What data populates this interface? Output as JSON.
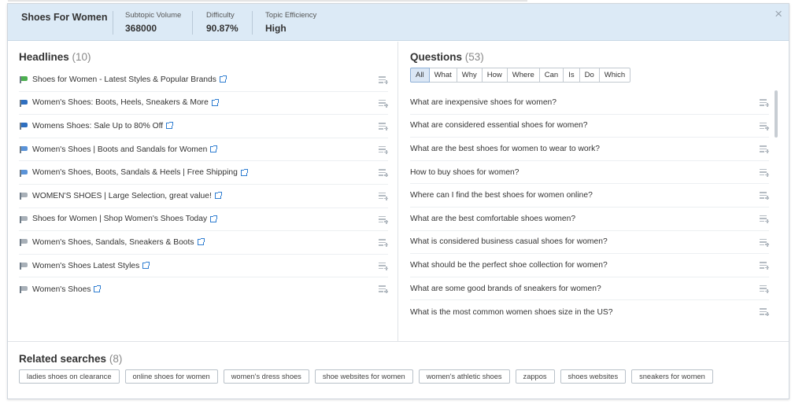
{
  "header": {
    "title": "Shoes For Women",
    "metrics": [
      {
        "label": "Subtopic Volume",
        "value": "368000"
      },
      {
        "label": "Difficulty",
        "value": "90.87%"
      },
      {
        "label": "Topic Efficiency",
        "value": "High"
      }
    ],
    "close_glyph": "×"
  },
  "headlines": {
    "title": "Headlines",
    "count": "(10)",
    "items": [
      {
        "text": "Shoes for Women - Latest Styles & Popular Brands",
        "flag": "green"
      },
      {
        "text": "Women's Shoes: Boots, Heels, Sneakers & More",
        "flag": "blue"
      },
      {
        "text": "Womens Shoes: Sale Up to 80% Off",
        "flag": "blue"
      },
      {
        "text": "Women's Shoes | Boots and Sandals for Women",
        "flag": "lightblue"
      },
      {
        "text": "Women's Shoes, Boots, Sandals & Heels | Free Shipping",
        "flag": "lightblue"
      },
      {
        "text": "WOMEN'S SHOES | Large Selection, great value!",
        "flag": "gray"
      },
      {
        "text": "Shoes for Women | Shop Women's Shoes Today",
        "flag": "gray"
      },
      {
        "text": "Women's Shoes, Sandals, Sneakers & Boots",
        "flag": "gray"
      },
      {
        "text": "Women's Shoes Latest Styles",
        "flag": "gray"
      },
      {
        "text": "Women's Shoes",
        "flag": "gray"
      }
    ]
  },
  "questions": {
    "title": "Questions",
    "count": "(53)",
    "filters": [
      "All",
      "What",
      "Why",
      "How",
      "Where",
      "Can",
      "Is",
      "Do",
      "Which"
    ],
    "active_filter": "All",
    "items": [
      "What are inexpensive shoes for women?",
      "What are considered essential shoes for women?",
      "What are the best shoes for women to wear to work?",
      "How to buy shoes for women?",
      "Where can I find the best shoes for women online?",
      "What are the best comfortable shoes women?",
      "What is considered business casual shoes for women?",
      "What should be the perfect shoe collection for women?",
      "What are some good brands of sneakers for women?",
      "What is the most common women shoes size in the US?"
    ]
  },
  "related": {
    "title": "Related searches",
    "count": "(8)",
    "items": [
      "ladies shoes on clearance",
      "online shoes for women",
      "women's dress shoes",
      "shoe websites for women",
      "women's athletic shoes",
      "zappos",
      "shoes websites",
      "sneakers for women"
    ]
  },
  "colors": {
    "green": "#4caf50",
    "blue": "#2f6fc0",
    "lightblue": "#5a93d8",
    "gray": "#a8b0b8",
    "link": "#2e7dd1",
    "header_bg": "#dceaf6"
  },
  "icons": {
    "flag": "flag-icon",
    "external": "external-link-icon",
    "add_to_list": "add-to-list-icon",
    "close": "close-icon"
  }
}
